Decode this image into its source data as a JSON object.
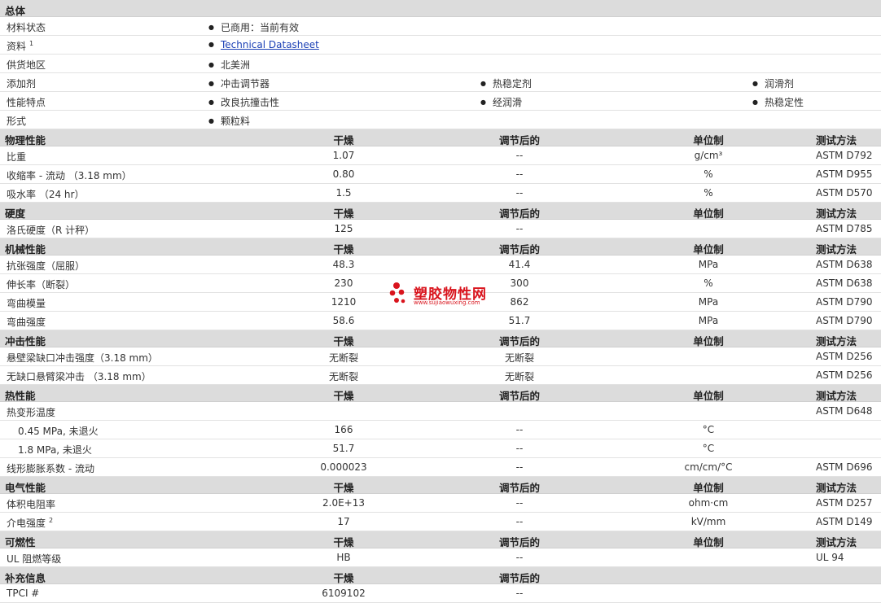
{
  "general": {
    "title": "总体",
    "rows": [
      {
        "label": "材料状态",
        "sup": "",
        "items": [
          "已商用：当前有效"
        ]
      },
      {
        "label": "资料",
        "sup": "1",
        "link": "Technical Datasheet",
        "items": []
      },
      {
        "label": "供货地区",
        "sup": "",
        "items": [
          "北美洲"
        ]
      },
      {
        "label": "添加剂",
        "sup": "",
        "items": [
          "冲击调节器",
          "热稳定剂",
          "润滑剂"
        ]
      },
      {
        "label": "性能特点",
        "sup": "",
        "items": [
          "改良抗撞击性",
          "经润滑",
          "热稳定性"
        ]
      },
      {
        "label": "形式",
        "sup": "",
        "items": [
          "颗粒料"
        ]
      }
    ]
  },
  "columns": {
    "dry": "干燥",
    "conditioned": "调节后的",
    "unit": "单位制",
    "test": "测试方法"
  },
  "sections": [
    {
      "title": "物理性能",
      "show_unit_test": true,
      "rows": [
        {
          "label": "比重",
          "dry": "1.07",
          "cond": "--",
          "unit": "g/cm³",
          "test": "ASTM D792"
        },
        {
          "label": "收缩率  - 流动 （3.18 mm）",
          "dry": "0.80",
          "cond": "--",
          "unit": "%",
          "test": "ASTM D955"
        },
        {
          "label": "吸水率 （24 hr）",
          "dry": "1.5",
          "cond": "--",
          "unit": "%",
          "test": "ASTM D570"
        }
      ]
    },
    {
      "title": "硬度",
      "show_unit_test": true,
      "rows": [
        {
          "label": "洛氏硬度（R 计秤）",
          "dry": "125",
          "cond": "--",
          "unit": "",
          "test": "ASTM D785"
        }
      ]
    },
    {
      "title": "机械性能",
      "show_unit_test": true,
      "rows": [
        {
          "label": "抗张强度（屈服）",
          "dry": "48.3",
          "cond": "41.4",
          "unit": "MPa",
          "test": "ASTM D638"
        },
        {
          "label": "伸长率（断裂）",
          "dry": "230",
          "cond": "300",
          "unit": "%",
          "test": "ASTM D638"
        },
        {
          "label": "弯曲模量",
          "dry": "1210",
          "cond": "862",
          "unit": "MPa",
          "test": "ASTM D790"
        },
        {
          "label": "弯曲强度",
          "dry": "58.6",
          "cond": "51.7",
          "unit": "MPa",
          "test": "ASTM D790"
        }
      ]
    },
    {
      "title": "冲击性能",
      "show_unit_test": true,
      "rows": [
        {
          "label": "悬壁梁缺口冲击强度（3.18 mm）",
          "dry": "无断裂",
          "cond": "无断裂",
          "unit": "",
          "test": "ASTM D256"
        },
        {
          "label": "无缺口悬臂梁冲击 （3.18 mm）",
          "dry": "无断裂",
          "cond": "无断裂",
          "unit": "",
          "test": "ASTM D256"
        }
      ]
    },
    {
      "title": "热性能",
      "show_unit_test": true,
      "rows": [
        {
          "label": "热变形温度",
          "dry": "",
          "cond": "",
          "unit": "",
          "test": "ASTM D648"
        },
        {
          "label": "0.45 MPa, 未退火",
          "indent": true,
          "dry": "166",
          "cond": "--",
          "unit": "°C",
          "test": ""
        },
        {
          "label": "1.8 MPa, 未退火",
          "indent": true,
          "dry": "51.7",
          "cond": "--",
          "unit": "°C",
          "test": ""
        },
        {
          "label": "线形膨胀系数  - 流动",
          "dry": "0.000023",
          "cond": "--",
          "unit": "cm/cm/°C",
          "test": "ASTM D696"
        }
      ]
    },
    {
      "title": "电气性能",
      "show_unit_test": true,
      "rows": [
        {
          "label": "体积电阻率",
          "dry": "2.0E+13",
          "cond": "--",
          "unit": "ohm·cm",
          "test": "ASTM D257"
        },
        {
          "label": "介电强度",
          "sup": "2",
          "dry": "17",
          "cond": "--",
          "unit": "kV/mm",
          "test": "ASTM D149"
        }
      ]
    },
    {
      "title": "可燃性",
      "show_unit_test": true,
      "rows": [
        {
          "label": "UL 阻燃等级",
          "dry": "HB",
          "cond": "--",
          "unit": "",
          "test": "UL 94"
        }
      ]
    },
    {
      "title": "补充信息",
      "show_unit_test": false,
      "rows": [
        {
          "label": "TPCI #",
          "dry": "6109102",
          "cond": "--",
          "unit": "",
          "test": ""
        }
      ]
    }
  ],
  "watermark": {
    "name": "塑胶物性网",
    "url": "www.sujiaowuxing.com",
    "color": "#d9141d"
  }
}
